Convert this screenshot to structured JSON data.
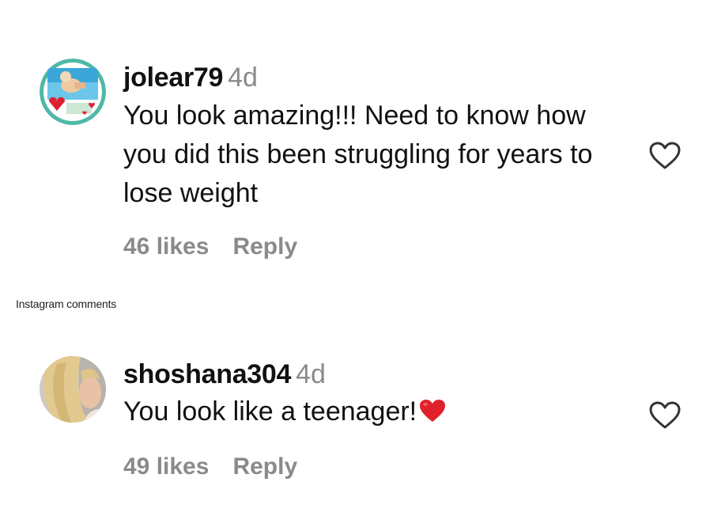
{
  "comments": [
    {
      "username": "jolear79",
      "time": "4d",
      "text": "You look amazing!!! Need to know how you did this been struggling for years to lose weight",
      "likes": "46 likes",
      "reply": "Reply"
    },
    {
      "username": "shoshana304",
      "time": "4d",
      "text": "You look like a teenager!",
      "text_emoji": "red-heart",
      "likes": "49 likes",
      "reply": "Reply"
    }
  ],
  "caption": "Instagram comments",
  "colors": {
    "text": "#111111",
    "muted": "#8a8a8a",
    "heart_emoji": "#e0202b"
  }
}
